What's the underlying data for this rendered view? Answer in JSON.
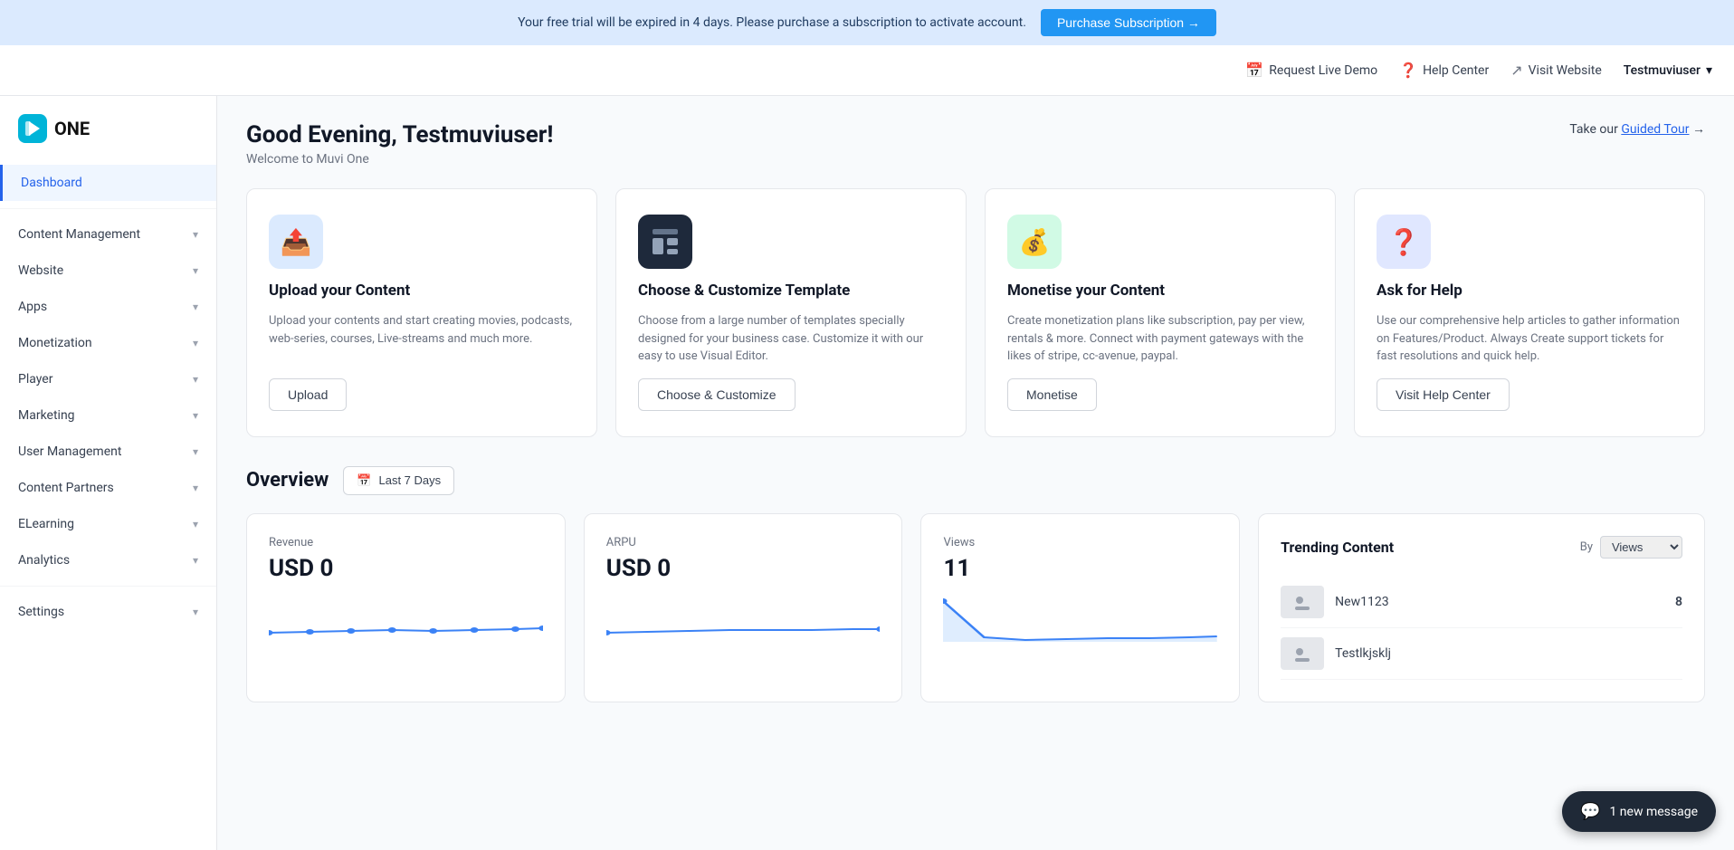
{
  "banner": {
    "text": "Your free trial will be expired in 4 days. Please purchase a subscription to activate account.",
    "button_label": "Purchase Subscription →"
  },
  "header": {
    "request_demo": "Request Live Demo",
    "help_center": "Help Center",
    "visit_website": "Visit Website",
    "user_name": "Testmuviuser",
    "chevron": "▾"
  },
  "sidebar": {
    "logo_text": "ONE",
    "items": [
      {
        "label": "Dashboard",
        "active": true,
        "has_chevron": false
      },
      {
        "label": "Content Management",
        "active": false,
        "has_chevron": true
      },
      {
        "label": "Website",
        "active": false,
        "has_chevron": true
      },
      {
        "label": "Apps",
        "active": false,
        "has_chevron": true
      },
      {
        "label": "Monetization",
        "active": false,
        "has_chevron": true
      },
      {
        "label": "Player",
        "active": false,
        "has_chevron": true
      },
      {
        "label": "Marketing",
        "active": false,
        "has_chevron": true
      },
      {
        "label": "User Management",
        "active": false,
        "has_chevron": true
      },
      {
        "label": "Content Partners",
        "active": false,
        "has_chevron": true
      },
      {
        "label": "ELearning",
        "active": false,
        "has_chevron": true
      },
      {
        "label": "Analytics",
        "active": false,
        "has_chevron": true
      },
      {
        "label": "Settings",
        "active": false,
        "has_chevron": true
      }
    ]
  },
  "greeting": {
    "title": "Good Evening, Testmuviuser!",
    "subtitle": "Welcome to Muvi One",
    "guided_tour_prefix": "Take our ",
    "guided_tour_link": "Guided Tour",
    "guided_tour_suffix": " →"
  },
  "cards": [
    {
      "icon": "📤",
      "icon_class": "blue",
      "title": "Upload your Content",
      "desc": "Upload your contents and start creating movies, podcasts, web-series, courses, Live-streams and much more.",
      "btn_label": "Upload"
    },
    {
      "icon": "🗂️",
      "icon_class": "dark",
      "title": "Choose & Customize Template",
      "desc": "Choose from a large number of templates specially designed for your business case. Customize it with our easy to use Visual Editor.",
      "btn_label": "Choose & Customize"
    },
    {
      "icon": "💰",
      "icon_class": "green",
      "title": "Monetise your Content",
      "desc": "Create monetization plans like subscription, pay per view, rentals & more. Connect with payment gateways with the likes of stripe, cc-avenue, paypal.",
      "btn_label": "Monetise"
    },
    {
      "icon": "❓",
      "icon_class": "indigo",
      "title": "Ask for Help",
      "desc": "Use our comprehensive help articles to gather information on Features/Product. Always Create support tickets for fast resolutions and quick help.",
      "btn_label": "Visit Help Center"
    }
  ],
  "overview": {
    "title": "Overview",
    "date_filter_icon": "📅",
    "date_filter_label": "Last 7 Days"
  },
  "stats": [
    {
      "label": "Revenue",
      "value": "USD 0"
    },
    {
      "label": "ARPU",
      "value": "USD 0"
    },
    {
      "label": "Views",
      "value": "11"
    }
  ],
  "trending": {
    "title": "Trending Content",
    "by_label": "By",
    "by_option": "Views",
    "items": [
      {
        "name": "New1123",
        "count": "8"
      },
      {
        "name": "Testlkjsklj",
        "count": ""
      }
    ]
  },
  "chat": {
    "icon": "💬",
    "label": "1 new message"
  }
}
